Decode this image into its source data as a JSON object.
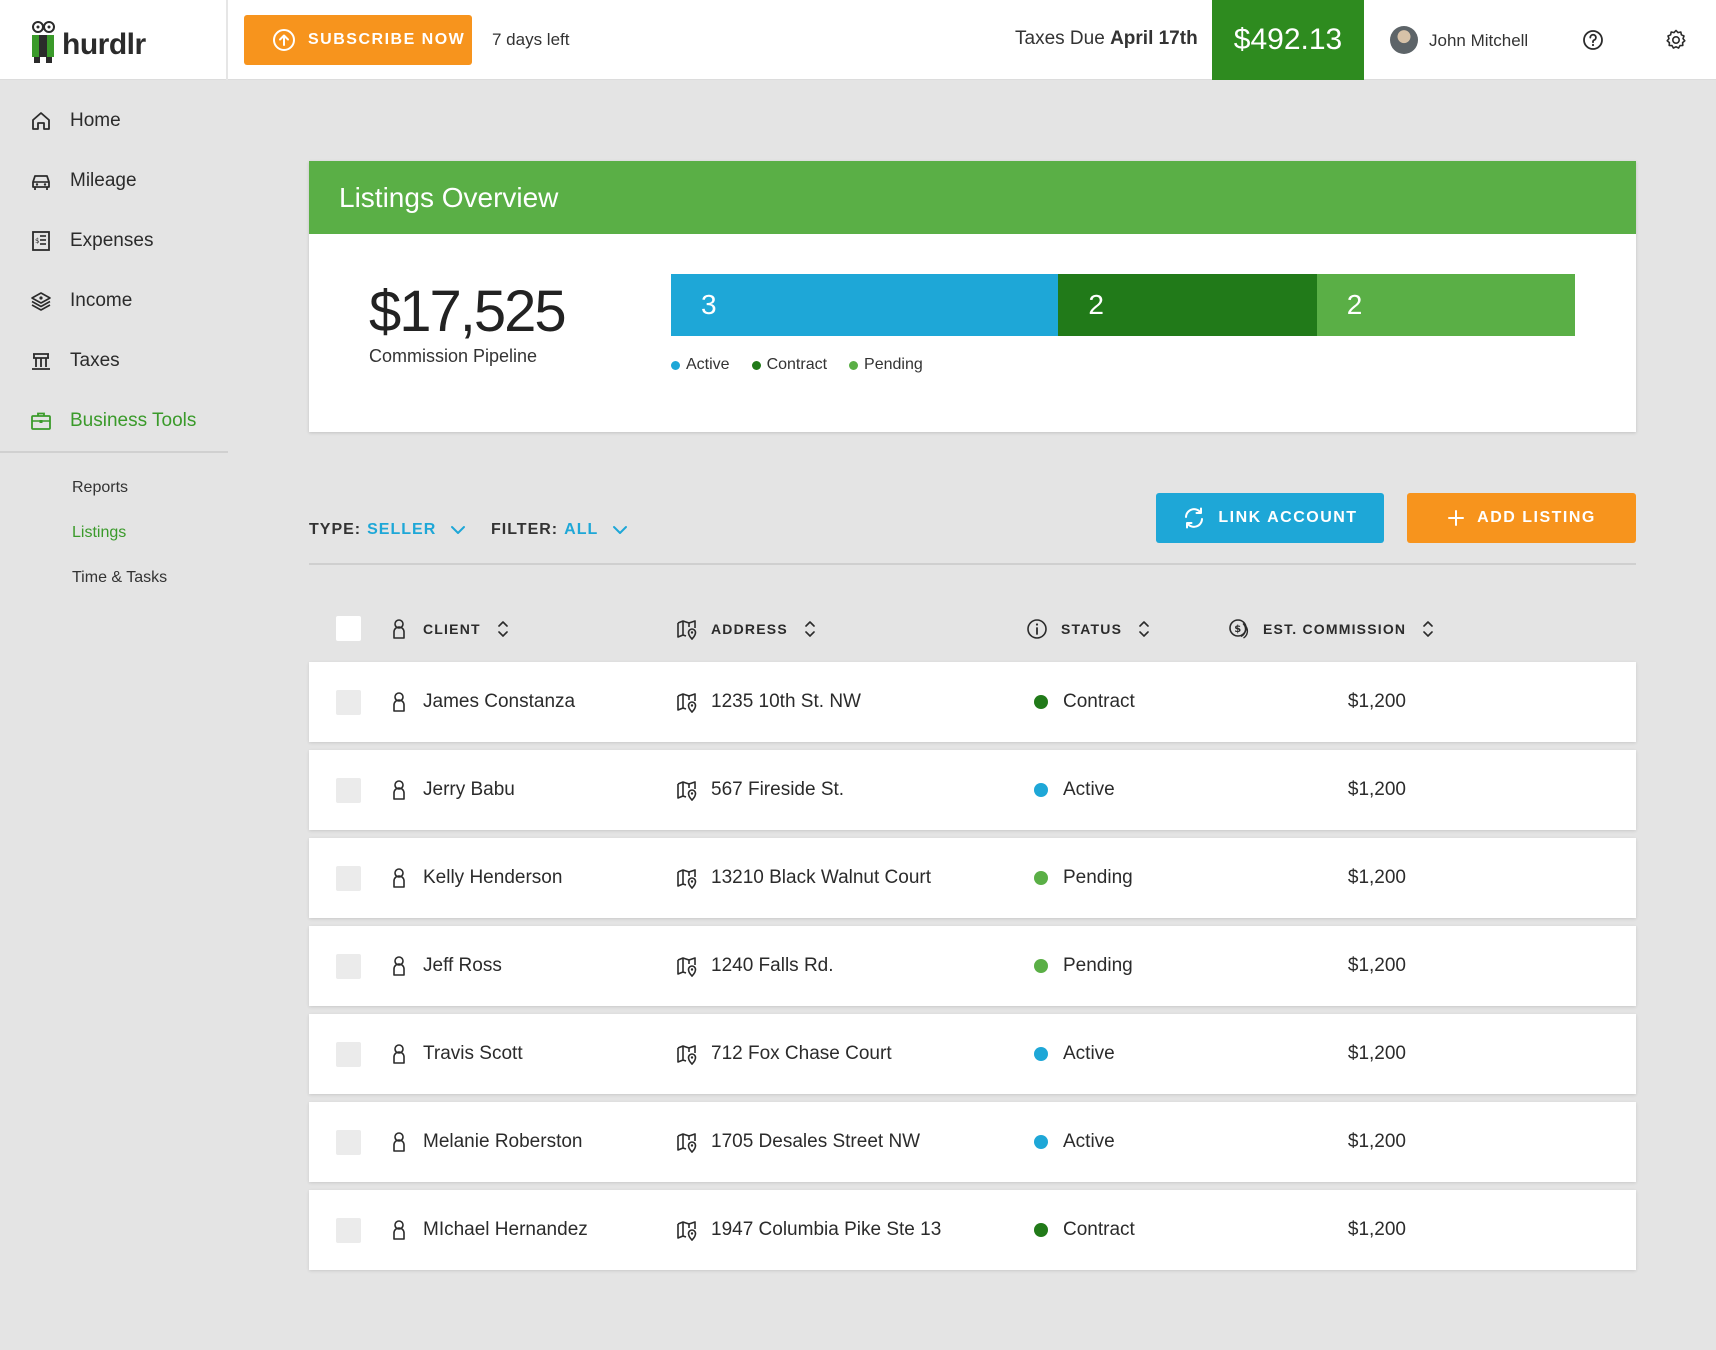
{
  "app": {
    "name": "hurdlr"
  },
  "topbar": {
    "subscribe_label": "SUBSCRIBE NOW",
    "days_left": "7 days left",
    "taxes_due_prefix": "Taxes Due",
    "taxes_due_date": "April 17th",
    "tax_amount": "$492.13",
    "user_name": "John Mitchell"
  },
  "sidebar": {
    "items": [
      {
        "label": "Home",
        "icon": "home-icon"
      },
      {
        "label": "Mileage",
        "icon": "car-icon"
      },
      {
        "label": "Expenses",
        "icon": "receipt-icon"
      },
      {
        "label": "Income",
        "icon": "money-icon"
      },
      {
        "label": "Taxes",
        "icon": "building-icon"
      },
      {
        "label": "Business Tools",
        "icon": "briefcase-icon",
        "active": true
      }
    ],
    "sub_items": [
      {
        "label": "Reports"
      },
      {
        "label": "Listings",
        "active": true
      },
      {
        "label": "Time & Tasks"
      }
    ]
  },
  "overview": {
    "title": "Listings Overview",
    "pipeline_value": "$17,525",
    "pipeline_label": "Commission Pipeline",
    "segments": [
      {
        "label": "Active",
        "count": "3",
        "color": "#1ea7d7"
      },
      {
        "label": "Contract",
        "count": "2",
        "color": "#217a19"
      },
      {
        "label": "Pending",
        "count": "2",
        "color": "#5aaf46"
      }
    ]
  },
  "filters": {
    "type_label": "TYPE:",
    "type_value": "SELLER",
    "filter_label": "FILTER:",
    "filter_value": "ALL"
  },
  "actions": {
    "link_account": "LINK ACCOUNT",
    "add_listing": "ADD LISTING"
  },
  "table": {
    "headers": {
      "client": "CLIENT",
      "address": "ADDRESS",
      "status": "STATUS",
      "commission": "EST. COMMISSION"
    },
    "rows": [
      {
        "client": "James Constanza",
        "address": "1235 10th St. NW",
        "status": "Contract",
        "commission": "$1,200"
      },
      {
        "client": "Jerry Babu",
        "address": "567 Fireside St.",
        "status": "Active",
        "commission": "$1,200"
      },
      {
        "client": "Kelly Henderson",
        "address": "13210 Black Walnut Court",
        "status": "Pending",
        "commission": "$1,200"
      },
      {
        "client": "Jeff Ross",
        "address": "1240 Falls Rd.",
        "status": "Pending",
        "commission": "$1,200"
      },
      {
        "client": "Travis Scott",
        "address": "712 Fox Chase Court",
        "status": "Active",
        "commission": "$1,200"
      },
      {
        "client": "Melanie Roberston",
        "address": "1705 Desales Street NW",
        "status": "Active",
        "commission": "$1,200"
      },
      {
        "client": "MIchael Hernandez",
        "address": "1947 Columbia Pike Ste 13",
        "status": "Contract",
        "commission": "$1,200"
      }
    ]
  },
  "colors": {
    "brand_green": "#5aaf46",
    "dark_green": "#217a19",
    "tax_green": "#2e8b1f",
    "blue": "#1ea7d7",
    "orange": "#f7941d",
    "status": {
      "Active": "#1ea7d7",
      "Contract": "#217a19",
      "Pending": "#5aaf46"
    }
  }
}
